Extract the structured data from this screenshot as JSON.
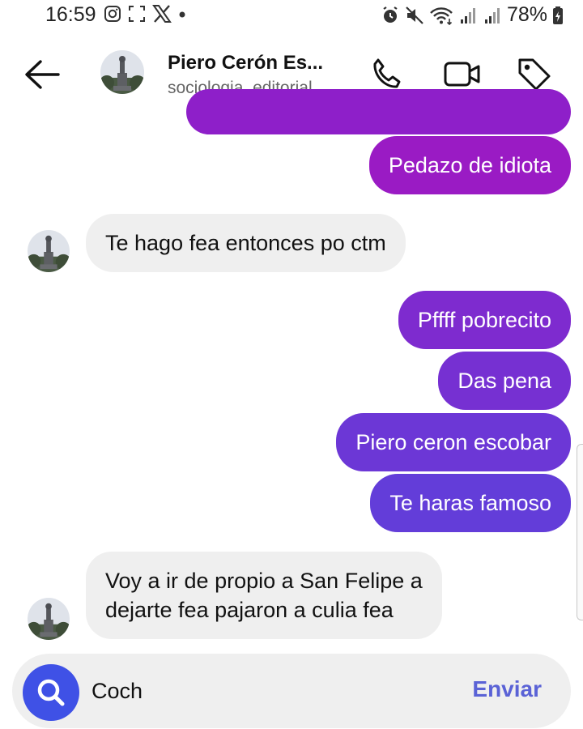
{
  "status_bar": {
    "time": "16:59",
    "battery": "78%"
  },
  "header": {
    "name": "Piero Cerón Es...",
    "handle": "sociologia_editorial_..."
  },
  "messages": [
    {
      "direction": "outgoing",
      "text": "",
      "color": "#8e1fc9"
    },
    {
      "direction": "outgoing",
      "text": "Pedazo de idiota",
      "color": "#9a1bc4"
    },
    {
      "direction": "incoming",
      "text": "Te hago fea entonces po ctm"
    },
    {
      "direction": "outgoing",
      "text": "Pffff pobrecito",
      "color": "#7e2bcf"
    },
    {
      "direction": "outgoing",
      "text": "Das pena",
      "color": "#7630d2"
    },
    {
      "direction": "outgoing",
      "text": "Piero ceron escobar",
      "color": "#6c37d6"
    },
    {
      "direction": "outgoing",
      "text": "Te haras famoso",
      "color": "#633dd9"
    },
    {
      "direction": "incoming",
      "text": "Voy a ir de propio a San Felipe a\ndejarte fea pajaron a culia fea"
    }
  ],
  "composer": {
    "value": "Coch",
    "send_label": "Enviar"
  }
}
